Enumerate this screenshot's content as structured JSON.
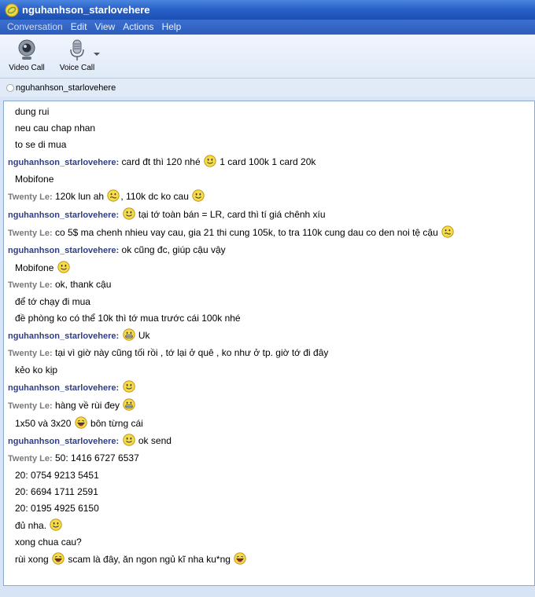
{
  "window": {
    "title": "nguhanhson_starlovehere"
  },
  "menu": [
    {
      "label": "Conversation"
    },
    {
      "label": "Edit"
    },
    {
      "label": "View"
    },
    {
      "label": "Actions"
    },
    {
      "label": "Help"
    }
  ],
  "toolbar": {
    "video_call_label": "Video Call",
    "voice_call_label": "Voice Call"
  },
  "contact": {
    "name": "nguhanhson_starlovehere"
  },
  "chat": {
    "messages": [
      {
        "kind": "cont",
        "parts": [
          {
            "t": "text",
            "v": "dung rui"
          }
        ]
      },
      {
        "kind": "cont",
        "parts": [
          {
            "t": "text",
            "v": "neu cau chap nhan"
          }
        ]
      },
      {
        "kind": "cont",
        "parts": [
          {
            "t": "text",
            "v": "to se di mua"
          }
        ]
      },
      {
        "kind": "head",
        "sender": "nguhanhson_starlovehere:",
        "who": "me",
        "parts": [
          {
            "t": "text",
            "v": "card đt thì 120 nhé "
          },
          {
            "t": "smile",
            "v": "smile"
          },
          {
            "t": "text",
            "v": " 1 card 100k 1 card 20k"
          }
        ]
      },
      {
        "kind": "cont",
        "parts": [
          {
            "t": "text",
            "v": "Mobifone"
          }
        ]
      },
      {
        "kind": "head",
        "sender": "Twenty Le:",
        "who": "them",
        "parts": [
          {
            "t": "text",
            "v": "120k lun ah "
          },
          {
            "t": "smile",
            "v": "worried"
          },
          {
            "t": "text",
            "v": ", 110k dc ko cau "
          },
          {
            "t": "smile",
            "v": "smile"
          }
        ]
      },
      {
        "kind": "head",
        "sender": "nguhanhson_starlovehere:",
        "who": "me",
        "parts": [
          {
            "t": "smile",
            "v": "smile"
          },
          {
            "t": "text",
            "v": " tại tớ toàn bán = LR, card thì tí giá chênh xíu"
          }
        ]
      },
      {
        "kind": "head",
        "sender": "Twenty Le:",
        "who": "them",
        "parts": [
          {
            "t": "text",
            "v": "co 5$ ma chenh nhieu vay cau, gia 21 thi cung 105k, to tra 110k cung dau co den noi tệ cậu "
          },
          {
            "t": "smile",
            "v": "worried"
          }
        ]
      },
      {
        "kind": "head",
        "sender": "nguhanhson_starlovehere:",
        "who": "me",
        "parts": [
          {
            "t": "text",
            "v": "ok cũng đc, giúp cậu vậy"
          }
        ]
      },
      {
        "kind": "cont",
        "parts": [
          {
            "t": "text",
            "v": "Mobifone "
          },
          {
            "t": "smile",
            "v": "smile"
          }
        ]
      },
      {
        "kind": "head",
        "sender": "Twenty Le:",
        "who": "them",
        "parts": [
          {
            "t": "text",
            "v": "ok, thank cậu"
          }
        ]
      },
      {
        "kind": "cont",
        "parts": [
          {
            "t": "text",
            "v": "để tớ chạy đi mua"
          }
        ]
      },
      {
        "kind": "cont",
        "parts": [
          {
            "t": "text",
            "v": "đề phòng ko có thể 10k thì tớ mua trước cái 100k nhé"
          }
        ]
      },
      {
        "kind": "head",
        "sender": "nguhanhson_starlovehere:",
        "who": "me",
        "parts": [
          {
            "t": "smile",
            "v": "grin"
          },
          {
            "t": "text",
            "v": " Uk"
          }
        ]
      },
      {
        "kind": "head",
        "sender": "Twenty Le:",
        "who": "them",
        "parts": [
          {
            "t": "text",
            "v": "tại vì giờ này cũng tối rồi , tớ lại ở quê , ko như ở tp. giờ tớ đi đây"
          }
        ]
      },
      {
        "kind": "cont",
        "parts": [
          {
            "t": "text",
            "v": "kẻo ko kịp"
          }
        ]
      },
      {
        "kind": "head",
        "sender": "nguhanhson_starlovehere:",
        "who": "me",
        "parts": [
          {
            "t": "smile",
            "v": "smile"
          }
        ]
      },
      {
        "kind": "head",
        "sender": "Twenty Le:",
        "who": "them",
        "parts": [
          {
            "t": "text",
            "v": "hàng về rùi đey "
          },
          {
            "t": "smile",
            "v": "grin"
          }
        ]
      },
      {
        "kind": "cont",
        "parts": [
          {
            "t": "text",
            "v": "1x50 và 3x20 "
          },
          {
            "t": "smile",
            "v": "laugh"
          },
          {
            "t": "text",
            "v": " bôn từng cái"
          }
        ]
      },
      {
        "kind": "head",
        "sender": "nguhanhson_starlovehere:",
        "who": "me",
        "parts": [
          {
            "t": "smile",
            "v": "smile"
          },
          {
            "t": "text",
            "v": " ok send"
          }
        ]
      },
      {
        "kind": "head",
        "sender": "Twenty Le:",
        "who": "them",
        "parts": [
          {
            "t": "text",
            "v": "50: 1416 6727 6537"
          }
        ]
      },
      {
        "kind": "cont",
        "parts": [
          {
            "t": "text",
            "v": "20: 0754 9213 5451"
          }
        ]
      },
      {
        "kind": "cont",
        "parts": [
          {
            "t": "text",
            "v": "20: 6694 1711 2591"
          }
        ]
      },
      {
        "kind": "cont",
        "parts": [
          {
            "t": "text",
            "v": "20: 0195 4925 6150"
          }
        ]
      },
      {
        "kind": "cont",
        "parts": [
          {
            "t": "text",
            "v": "đủ nha. "
          },
          {
            "t": "smile",
            "v": "smile"
          }
        ]
      },
      {
        "kind": "cont",
        "parts": [
          {
            "t": "text",
            "v": "xong chua cau?"
          }
        ]
      },
      {
        "kind": "cont",
        "parts": [
          {
            "t": "text",
            "v": "rùi xong "
          },
          {
            "t": "smile",
            "v": "laugh"
          },
          {
            "t": "text",
            "v": " scam là đây, ăn ngon ngủ kĩ nha ku*ng "
          },
          {
            "t": "smile",
            "v": "laugh"
          }
        ]
      }
    ]
  },
  "colors": {
    "sender_me": "#2e3d86",
    "sender_them": "#7a7a7a",
    "titlebar": "#2a62c9"
  },
  "icons": {
    "app": "messenger-icon",
    "video": "webcam-icon",
    "voice": "microphone-icon"
  }
}
